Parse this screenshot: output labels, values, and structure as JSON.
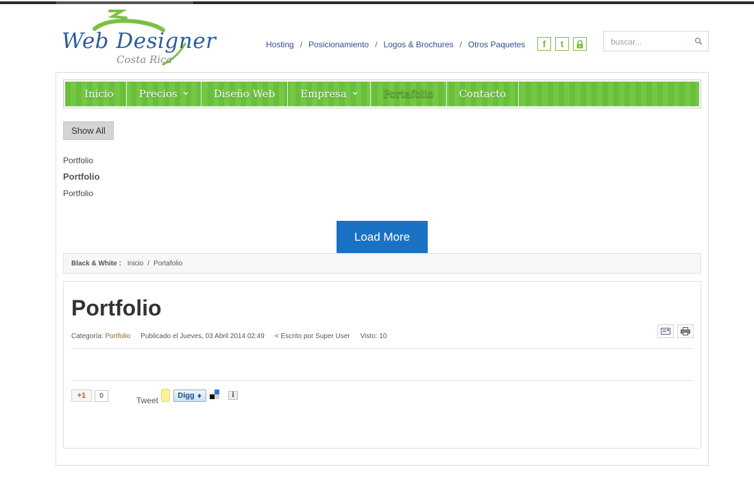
{
  "logo": {
    "main": "Web Designer",
    "sub": "Costa Rica"
  },
  "topnav": {
    "items": [
      "Hosting",
      "Posicionamiento",
      "Logos & Brochures",
      "Otros Paquetes"
    ],
    "separator": "/"
  },
  "social": {
    "facebook": "f",
    "twitter": "t"
  },
  "search": {
    "placeholder": "buscar..."
  },
  "menu": {
    "items": [
      {
        "label": "Inicio"
      },
      {
        "label": "Precios"
      },
      {
        "label": "Diseño Web"
      },
      {
        "label": "Empresa"
      },
      {
        "label": "Portafolio"
      },
      {
        "label": "Contacto"
      }
    ]
  },
  "filters": {
    "show_all": "Show All",
    "cat1": "Portfolio",
    "cat2": "Portfolio",
    "cat3": "Portfolio"
  },
  "load_more": "Load More",
  "breadcrumb": {
    "label": "Black & White :",
    "home": "Inicio",
    "sep": "/",
    "current": "Portafolio"
  },
  "article": {
    "title": "Portfolio",
    "category_label": "Categoría:",
    "category": "Portfolio",
    "published": "Publicado el Jueves, 03 Abril 2014 02:49",
    "author": "< Escrito por Super User",
    "hits": "Visto: 10"
  },
  "share": {
    "gplus": "+1",
    "gplus_count": "0",
    "tweet": "Tweet",
    "digg": "Digg",
    "info": "i"
  },
  "colors": {
    "brand_green": "#6abf3a",
    "link_blue": "#2d4e8c",
    "button_blue": "#1a72c4"
  }
}
